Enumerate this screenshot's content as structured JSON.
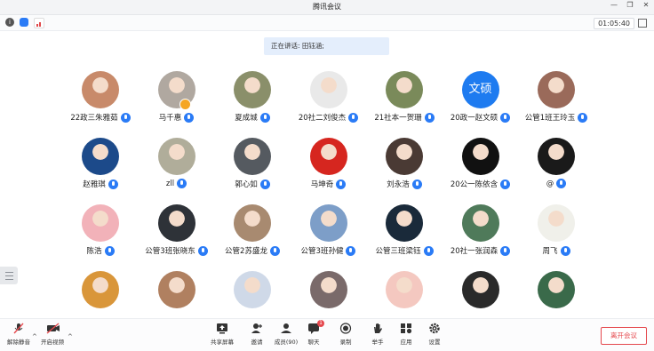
{
  "window": {
    "title": "腾讯会议",
    "timer": "01:05:40"
  },
  "speaking": {
    "label": "正在讲话: 田钰涵;"
  },
  "participants": [
    {
      "name": "22政三朱雅茹",
      "avatar": "photo",
      "color": "#c88a6a"
    },
    {
      "name": "马千惠",
      "avatar": "photo",
      "color": "#b0a8a0",
      "host": true
    },
    {
      "name": "夏成城",
      "avatar": "photo",
      "color": "#8a8f6a"
    },
    {
      "name": "20社二刘俊杰",
      "avatar": "photo",
      "color": "#e9e9e9"
    },
    {
      "name": "21社本一贺珊",
      "avatar": "photo",
      "color": "#7a8a5a"
    },
    {
      "name": "20政一赵文硕",
      "avatar": "text",
      "text": "文硕",
      "color": "#1e7bf0"
    },
    {
      "name": "公管1班王玲玉",
      "avatar": "photo",
      "color": "#9a6a5a"
    },
    {
      "name": "赵雅琪",
      "avatar": "photo",
      "color": "#1c4a8a"
    },
    {
      "name": "zll",
      "avatar": "photo",
      "color": "#b0ad9a"
    },
    {
      "name": "郭心如",
      "avatar": "photo",
      "color": "#555a60"
    },
    {
      "name": "马坤奇",
      "avatar": "photo",
      "color": "#d6261f"
    },
    {
      "name": "刘永浩",
      "avatar": "photo",
      "color": "#4a3a34"
    },
    {
      "name": "20公一陈依含",
      "avatar": "photo",
      "color": "#111111"
    },
    {
      "name": "@",
      "avatar": "photo",
      "color": "#1a1a1a"
    },
    {
      "name": "陈浩",
      "avatar": "photo",
      "color": "#f2b2b9"
    },
    {
      "name": "公管3班张晓东",
      "avatar": "photo",
      "color": "#2e3238"
    },
    {
      "name": "公管2苏盛龙",
      "avatar": "photo",
      "color": "#a88a70"
    },
    {
      "name": "公管3班孙健",
      "avatar": "photo",
      "color": "#7d9ec8"
    },
    {
      "name": "公管三班梁钰",
      "avatar": "photo",
      "color": "#1a2a3a"
    },
    {
      "name": "20社一张润森",
      "avatar": "photo",
      "color": "#4f7a5a"
    },
    {
      "name": "周飞",
      "avatar": "photo",
      "color": "#f0f0ea"
    },
    {
      "name": "",
      "avatar": "photo",
      "color": "#d9963a"
    },
    {
      "name": "",
      "avatar": "photo",
      "color": "#b08060"
    },
    {
      "name": "",
      "avatar": "photo",
      "color": "#cfd9e8"
    },
    {
      "name": "",
      "avatar": "photo",
      "color": "#7a6a6a"
    },
    {
      "name": "",
      "avatar": "photo",
      "color": "#f4c8c0"
    },
    {
      "name": "",
      "avatar": "photo",
      "color": "#2a2a2a"
    },
    {
      "name": "",
      "avatar": "photo",
      "color": "#3a6a4a"
    }
  ],
  "toolbar": {
    "mute": "解除静音",
    "video": "开启视频",
    "share": "共享屏幕",
    "invite": "邀请",
    "members": "成员(90)",
    "chat": "聊天",
    "chat_badge": "1",
    "record": "录制",
    "hand": "举手",
    "apps": "应用",
    "settings": "设置",
    "leave": "离开会议"
  },
  "colors": {
    "accent": "#2a7bf6",
    "danger": "#e5484d"
  }
}
